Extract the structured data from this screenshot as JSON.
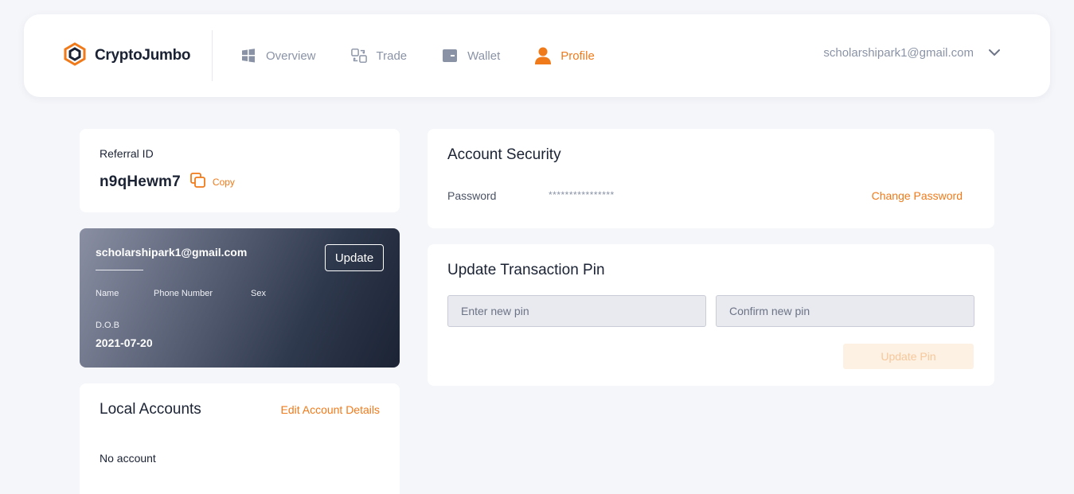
{
  "brand": {
    "name": "CryptoJumbo",
    "accent": "#f07a1a"
  },
  "nav": {
    "items": [
      {
        "label": "Overview",
        "icon": "windows-grid-icon",
        "active": false
      },
      {
        "label": "Trade",
        "icon": "exchange-icon",
        "active": false
      },
      {
        "label": "Wallet",
        "icon": "wallet-icon",
        "active": false
      },
      {
        "label": "Profile",
        "icon": "user-icon",
        "active": true
      }
    ],
    "user_email": "scholarshipark1@gmail.com"
  },
  "referral": {
    "label": "Referral ID",
    "code": "n9qHewm7",
    "copy_label": "Copy"
  },
  "profile_card": {
    "email": "scholarshipark1@gmail.com",
    "update_label": "Update",
    "name_label": "Name",
    "phone_label": "Phone Number",
    "sex_label": "Sex",
    "dob_label": "D.O.B",
    "dob_value": "2021-07-20"
  },
  "local_accounts": {
    "title": "Local Accounts",
    "edit_label": "Edit Account Details",
    "empty_text": "No account"
  },
  "security": {
    "title": "Account Security",
    "password_label": "Password",
    "password_mask": "****************",
    "change_label": "Change Password"
  },
  "pin": {
    "title": "Update Transaction Pin",
    "new_placeholder": "Enter new pin",
    "confirm_placeholder": "Confirm new pin",
    "update_label": "Update Pin"
  }
}
